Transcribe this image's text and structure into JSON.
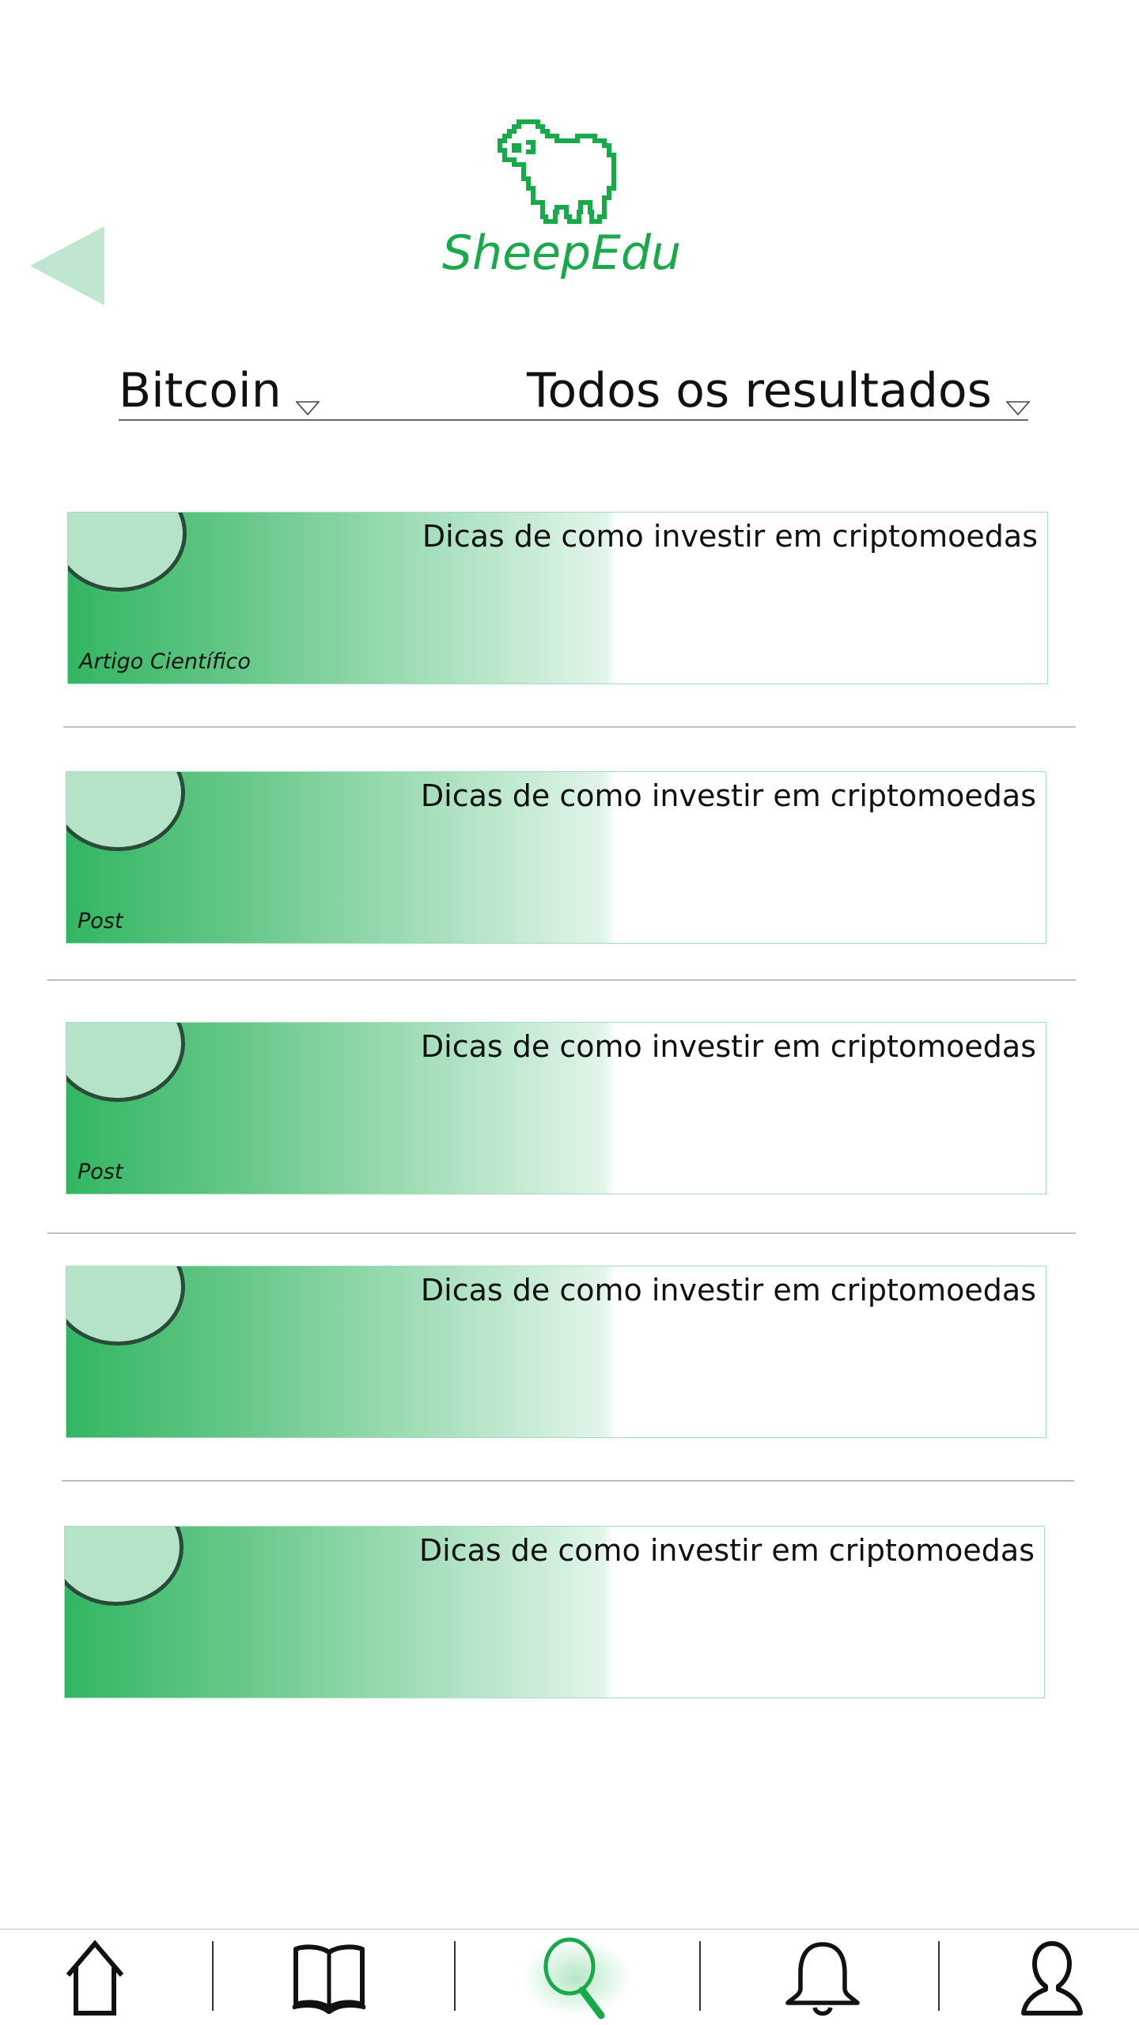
{
  "app": {
    "brand_name": "SheepEdu",
    "brand_color": "#17a94a",
    "back_icon": "back-triangle-icon",
    "logo_icon": "sheep-icon"
  },
  "filters": {
    "topic": "Bitcoin",
    "results": "Todos os resultados"
  },
  "results": [
    {
      "title": "Dicas de como investir em criptomoedas",
      "type": "Artigo Científico"
    },
    {
      "title": "Dicas de como investir em criptomoedas",
      "type": "Post"
    },
    {
      "title": "Dicas de como investir em criptomoedas",
      "type": "Post"
    },
    {
      "title": "Dicas de como investir em criptomoedas",
      "type": ""
    },
    {
      "title": "Dicas de como investir em criptomoedas",
      "type": ""
    }
  ],
  "nav": {
    "items": [
      {
        "icon": "home-icon",
        "active": false
      },
      {
        "icon": "book-icon",
        "active": false
      },
      {
        "icon": "search-icon",
        "active": true
      },
      {
        "icon": "bell-icon",
        "active": false
      },
      {
        "icon": "profile-icon",
        "active": false
      }
    ],
    "active_color": "#17a94a"
  },
  "colors": {
    "accent": "#17a94a",
    "card_green": "#32b662",
    "thumb_fill": "#b5e3c8",
    "back_arrow": "#bfe6cf"
  }
}
